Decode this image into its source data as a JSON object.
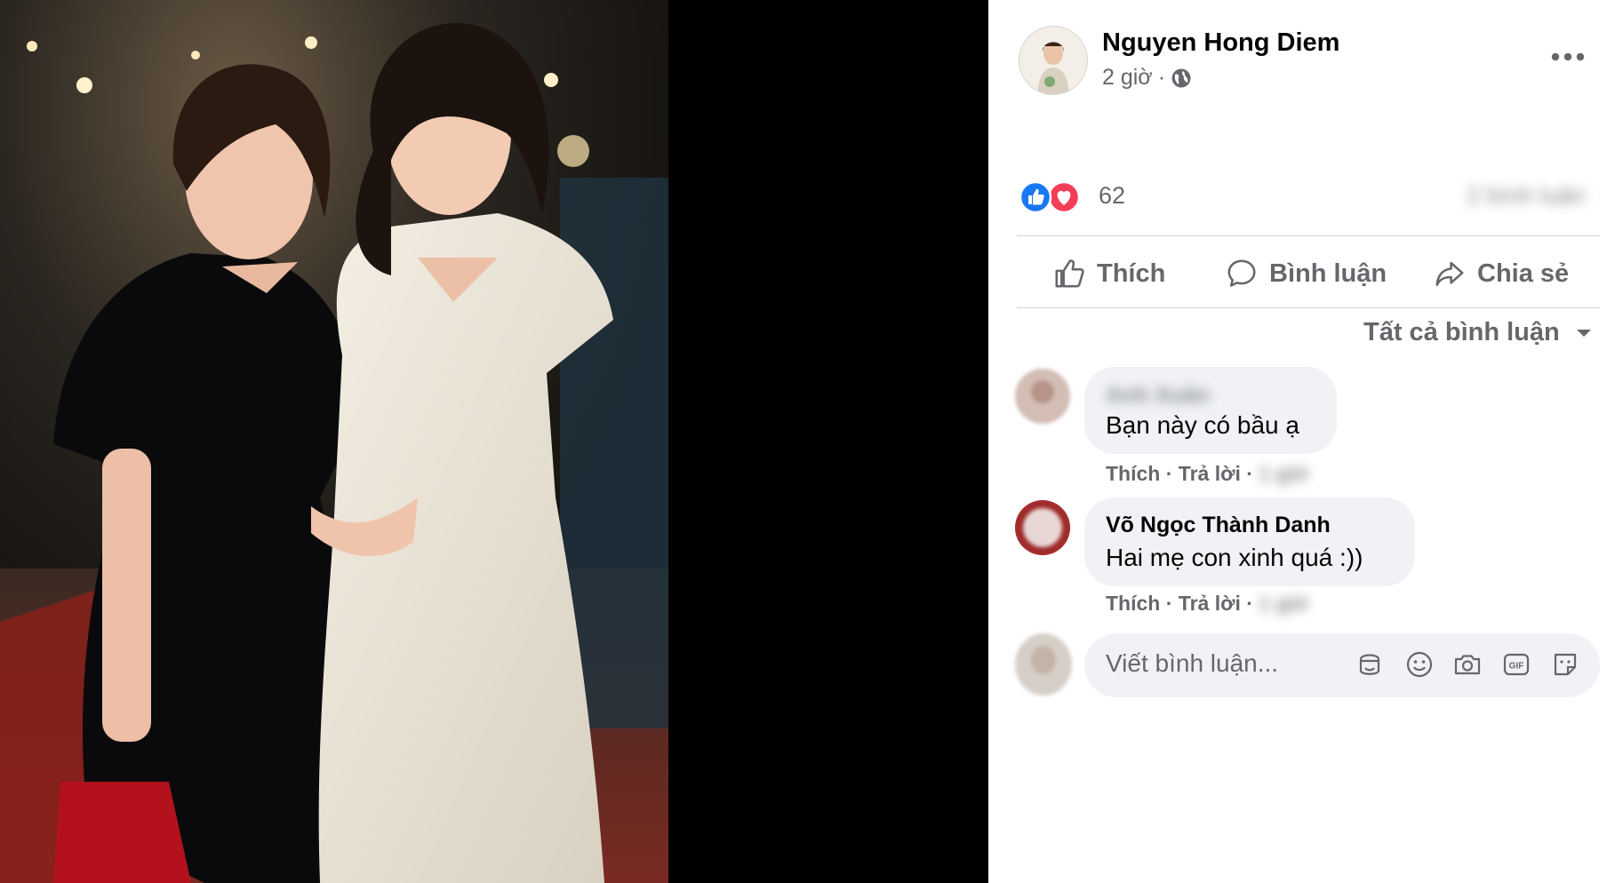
{
  "post": {
    "author": "Nguyen Hong Diem",
    "time": "2 giờ",
    "separator": "·",
    "privacy_icon": "globe-icon",
    "more_icon": "more-horizontal-icon"
  },
  "reactions": {
    "icons": [
      "like-reaction-icon",
      "love-reaction-icon"
    ],
    "count": "62",
    "comments_count": "2 bình luận"
  },
  "actions": {
    "like": "Thích",
    "comment": "Bình luận",
    "share": "Chia sẻ"
  },
  "filter": {
    "label": "Tất cả bình luận"
  },
  "comments": [
    {
      "author": "Anh Xuân",
      "text": "Bạn này có bầu ạ",
      "like": "Thích",
      "reply": "Trả lời",
      "time": "1 giờ"
    },
    {
      "author": "Võ Ngọc Thành Danh",
      "text": "Hai mẹ con xinh quá :))",
      "like": "Thích",
      "reply": "Trả lời",
      "time": "1 giờ"
    }
  ],
  "composer": {
    "placeholder": "Viết bình luận...",
    "icons": [
      "avatar-sticker-icon",
      "emoji-icon",
      "camera-icon",
      "gif-icon",
      "sticker-icon"
    ]
  },
  "colors": {
    "like_blue": "#1877f2",
    "love_red": "#f33e58",
    "secondary_text": "#65676b",
    "bubble_bg": "#f0f2f5"
  }
}
